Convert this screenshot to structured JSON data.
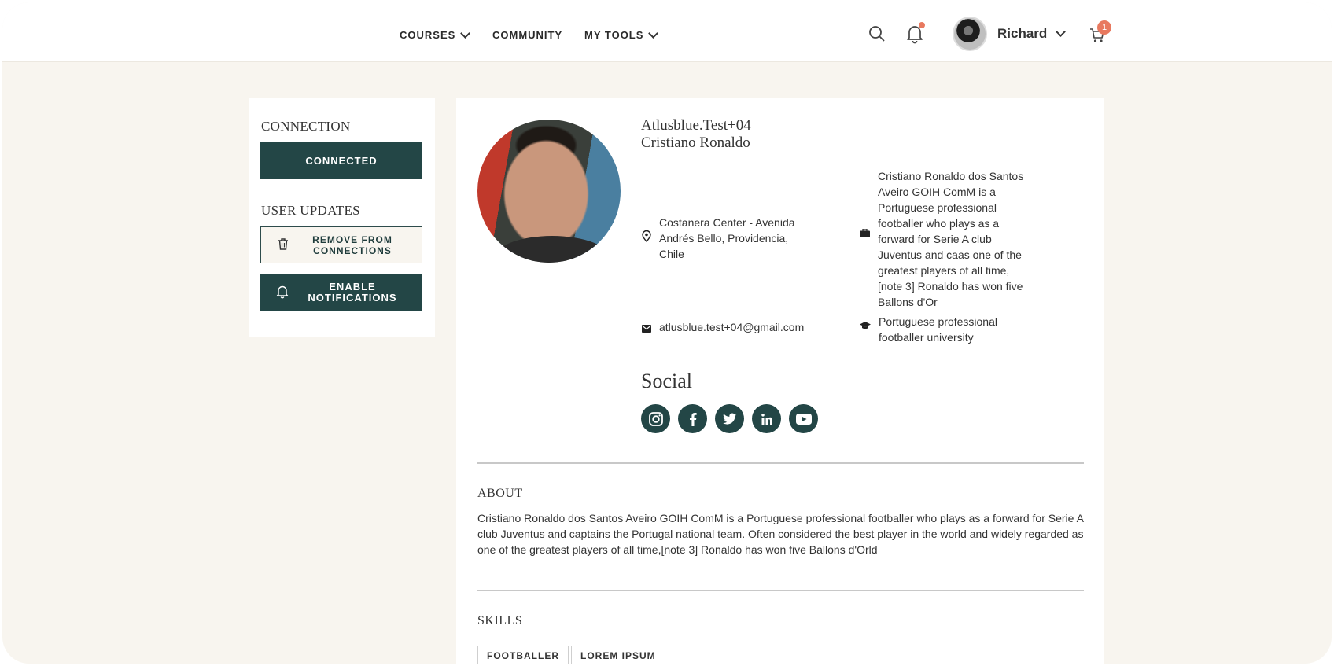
{
  "nav": {
    "courses": "COURSES",
    "community": "COMMUNITY",
    "my_tools": "MY TOOLS"
  },
  "header": {
    "user_name": "Richard",
    "cart_count": "1",
    "icons": [
      "search-icon",
      "bell-icon",
      "cart-icon"
    ],
    "notification_dot_color": "#e8795f"
  },
  "sidebar": {
    "connection_title": "CONNECTION",
    "connected_label": "CONNECTED",
    "user_updates_title": "USER UPDATES",
    "remove_label": "REMOVE FROM CONNECTIONS",
    "notify_label": "ENABLE NOTIFICATIONS"
  },
  "profile": {
    "handle": "Atlusblue.Test+04",
    "full_name": "Cristiano Ronaldo",
    "location": "Costanera Center - Avenida Andrés Bello, Providencia, Chile",
    "email": "atlusblue.test+04@gmail.com",
    "occupation": "Cristiano Ronaldo dos Santos Aveiro GOIH ComM is a Portuguese professional footballer who plays as a forward for Serie A club Juventus and caas one of the greatest players of all time,[note 3] Ronaldo has won five Ballons d'Or",
    "education": "Portuguese professional footballer university"
  },
  "social": {
    "title": "Social",
    "links": [
      "instagram-icon",
      "facebook-icon",
      "twitter-icon",
      "linkedin-icon",
      "youtube-icon"
    ]
  },
  "about": {
    "title": "ABOUT",
    "text": "Cristiano Ronaldo dos Santos Aveiro GOIH ComM is a Portuguese professional footballer who plays as a forward for Serie A club Juventus and captains the Portugal national team. Often considered the best player in the world and widely regarded as one of the greatest players of all time,[note 3] Ronaldo has won five Ballons d'Orld"
  },
  "skills": {
    "title": "SKILLS",
    "tags": [
      "FOOTBALLER",
      "LOREM IPSUM"
    ]
  },
  "colors": {
    "accent": "#234646",
    "background": "#f8f5ef",
    "badge": "#e8795f"
  }
}
